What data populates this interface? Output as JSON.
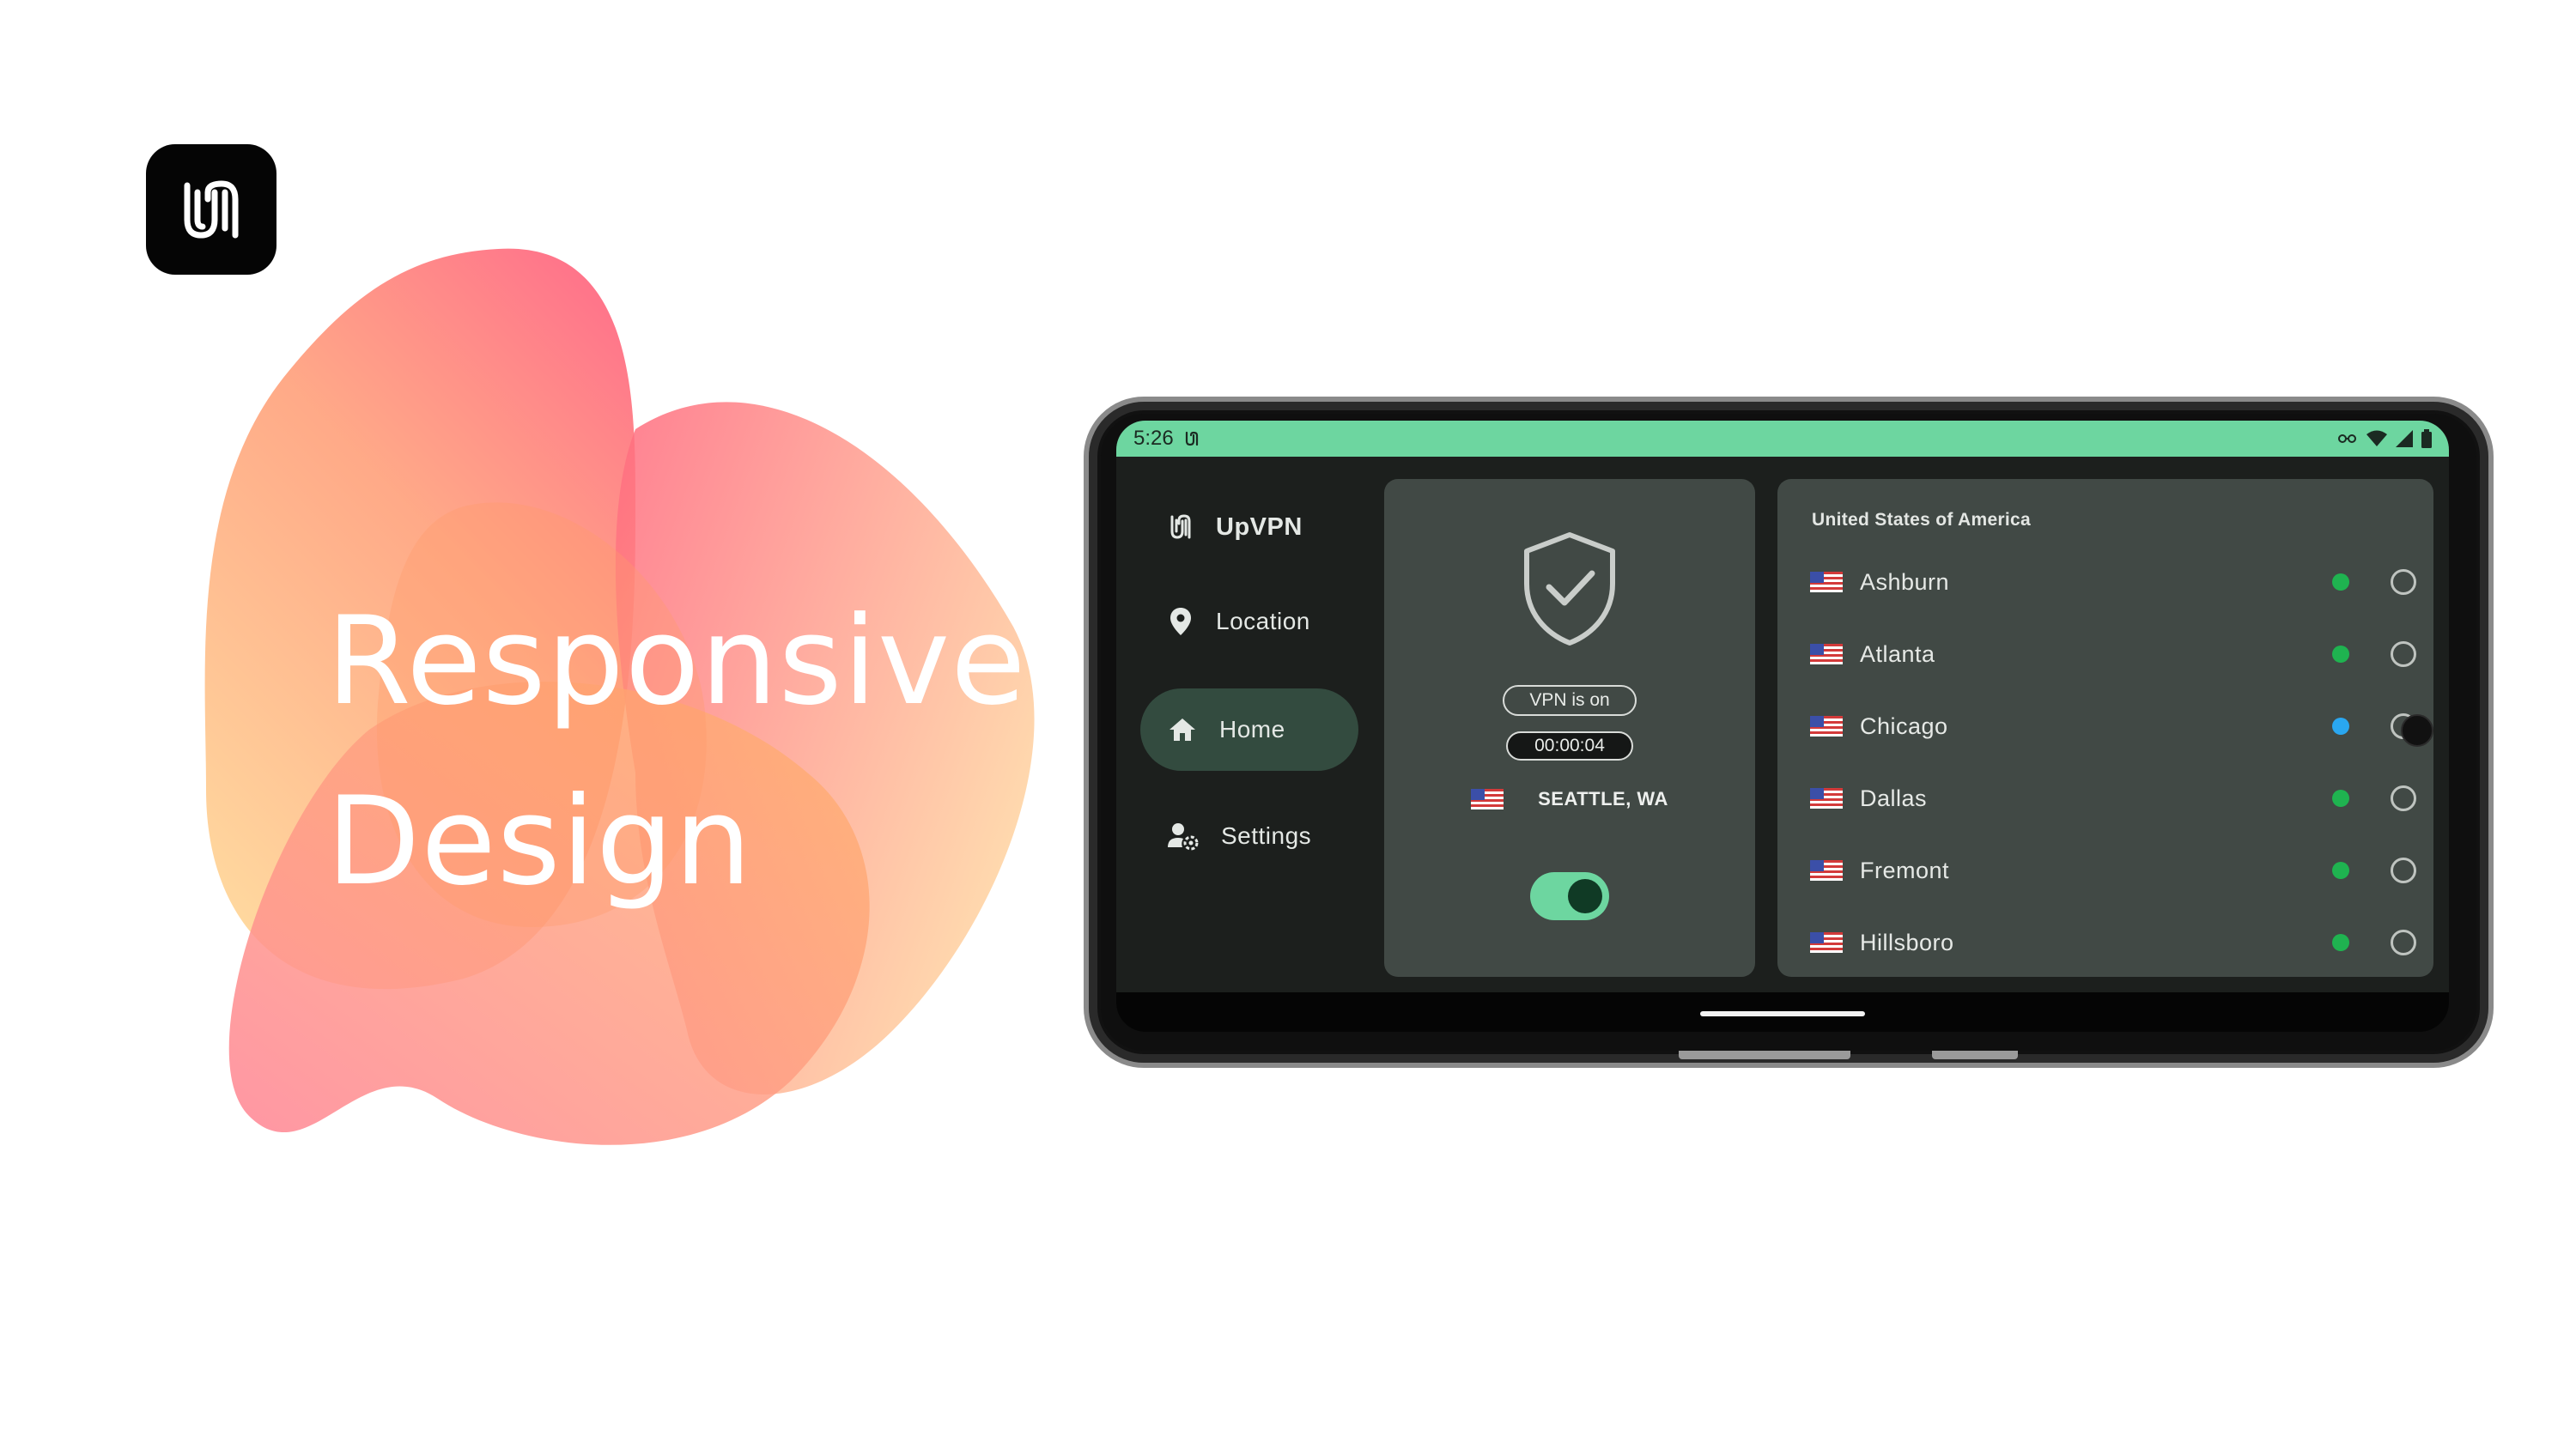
{
  "hero": {
    "line1": "Responsive",
    "line2": "Design"
  },
  "phone": {
    "status_bar": {
      "time": "5:26"
    },
    "nav": {
      "app_title": "UpVPN",
      "items": [
        {
          "label": "Location",
          "icon": "location-pin-icon",
          "active": false
        },
        {
          "label": "Home",
          "icon": "home-icon",
          "active": true
        },
        {
          "label": "Settings",
          "icon": "manage-accounts-icon",
          "active": false
        }
      ]
    },
    "vpn_card": {
      "status": "VPN is on",
      "timer": "00:00:04",
      "current_location": "SEATTLE, WA",
      "toggle_on": true
    },
    "server_list": {
      "country": "United States of America",
      "servers": [
        {
          "name": "Ashburn",
          "status_color": "#1fb350"
        },
        {
          "name": "Atlanta",
          "status_color": "#1fb350"
        },
        {
          "name": "Chicago",
          "status_color": "#2aa7f0"
        },
        {
          "name": "Dallas",
          "status_color": "#1fb350"
        },
        {
          "name": "Fremont",
          "status_color": "#1fb350"
        },
        {
          "name": "Hillsboro",
          "status_color": "#1fb350"
        }
      ]
    }
  },
  "colors": {
    "accent": "#6dd6a0",
    "surface": "#414945",
    "background": "#1c1f1d",
    "nav_active": "#334b3f"
  }
}
